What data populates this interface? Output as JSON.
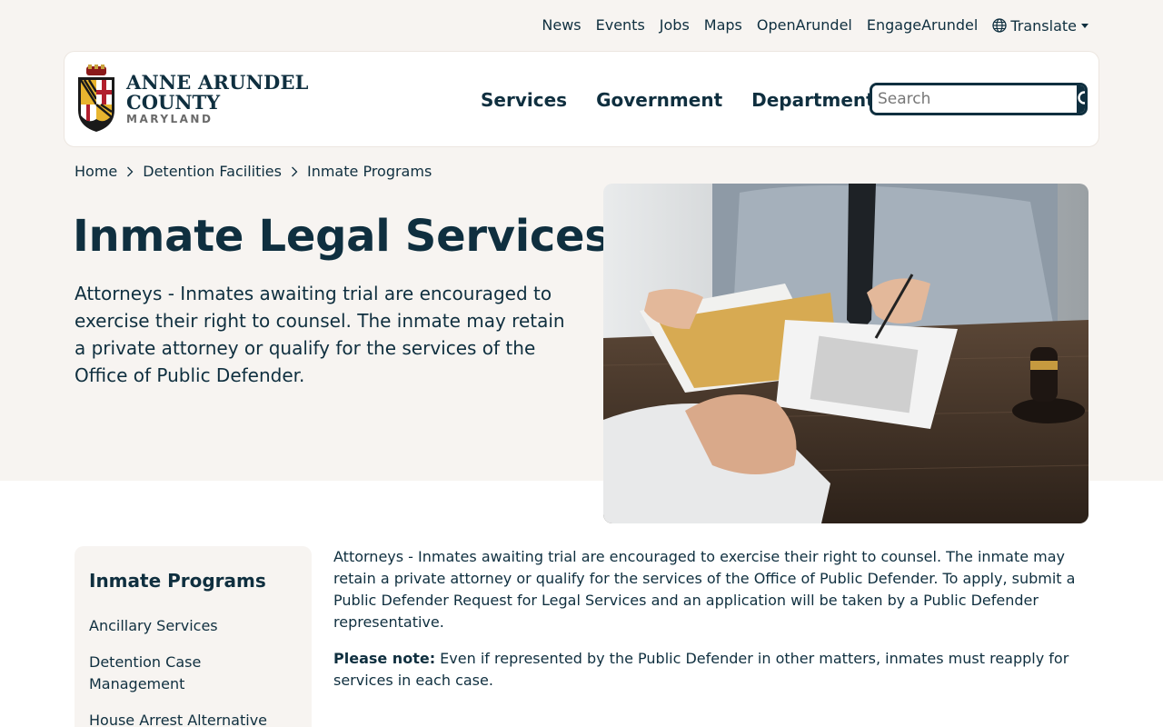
{
  "utility_nav": [
    "News",
    "Events",
    "Jobs",
    "Maps",
    "OpenArundel",
    "EngageArundel"
  ],
  "translate_label": "Translate",
  "logo": {
    "line1": "ANNE ARUNDEL",
    "line2": "COUNTY",
    "line3": "MARYLAND"
  },
  "main_nav": [
    "Services",
    "Government",
    "Departments"
  ],
  "search": {
    "placeholder": "Search"
  },
  "breadcrumb": [
    "Home",
    "Detention Facilities",
    "Inmate Programs"
  ],
  "page_title": "Inmate Legal Services",
  "lead": "Attorneys - Inmates awaiting trial are encouraged to exercise their right to counsel. The inmate may retain a private attorney or qualify for the services of the Office of Public Defender.",
  "sidenav": {
    "title": "Inmate Programs",
    "items": [
      "Ancillary Services",
      "Detention Case Management",
      "House Arrest Alternative Sentencing Program"
    ]
  },
  "content": {
    "p1": "Attorneys - Inmates awaiting trial are encouraged to exercise their right to counsel.  The inmate may retain a private attorney or  qualify for the services of the Office of Public Defender.  To apply, submit a Public Defender Request for Legal Services and an application will be taken by a Public Defender representative.",
    "note_label": "Please note:",
    "note_text": " Even if represented by the Public Defender in other matters, inmates must reapply for services in each case."
  },
  "colors": {
    "primary": "#0f2f3f",
    "hero_bg": "#f7f4f1"
  }
}
